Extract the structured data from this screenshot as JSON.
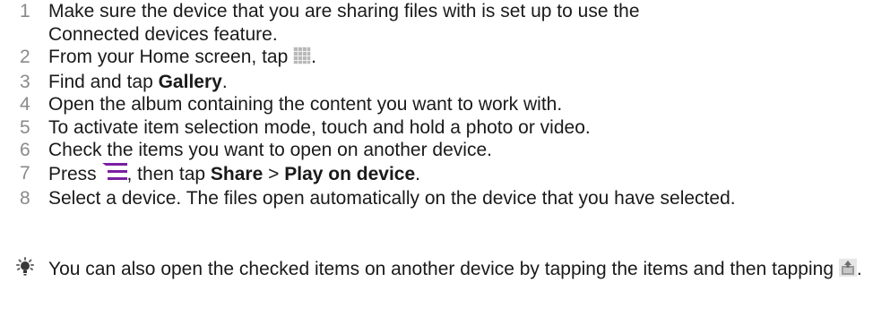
{
  "steps": [
    {
      "num": "1",
      "line1": "Make sure the device that you are sharing files with is set up to use the",
      "line2": "Connected devices feature."
    },
    {
      "num": "2",
      "before": "From your Home screen, tap ",
      "after": ".",
      "icon": "apps-grid-icon"
    },
    {
      "num": "3",
      "before": "Find and tap ",
      "bold": "Gallery",
      "after": "."
    },
    {
      "num": "4",
      "text": "Open the album containing the content you want to work with."
    },
    {
      "num": "5",
      "text": "To activate item selection mode, touch and hold a photo or video."
    },
    {
      "num": "6",
      "text": "Check the items you want to open on another device."
    },
    {
      "num": "7",
      "before": "Press ",
      "mid": ", then tap ",
      "bold1": "Share",
      "sep": " > ",
      "bold2": "Play on device",
      "after": ".",
      "icon": "menu-icon"
    },
    {
      "num": "8",
      "text": "Select a device. The files open automatically on the device that you have selected."
    }
  ],
  "tip": {
    "icon": "lightbulb-icon",
    "text": "You can also open the checked items on another device by tapping the items and then tapping ",
    "end": ".",
    "end_icon": "share-device-icon"
  },
  "colors": {
    "number": "#8a8a8a",
    "menu_icon": "#7a1fa2",
    "text": "#1a1a1a"
  }
}
